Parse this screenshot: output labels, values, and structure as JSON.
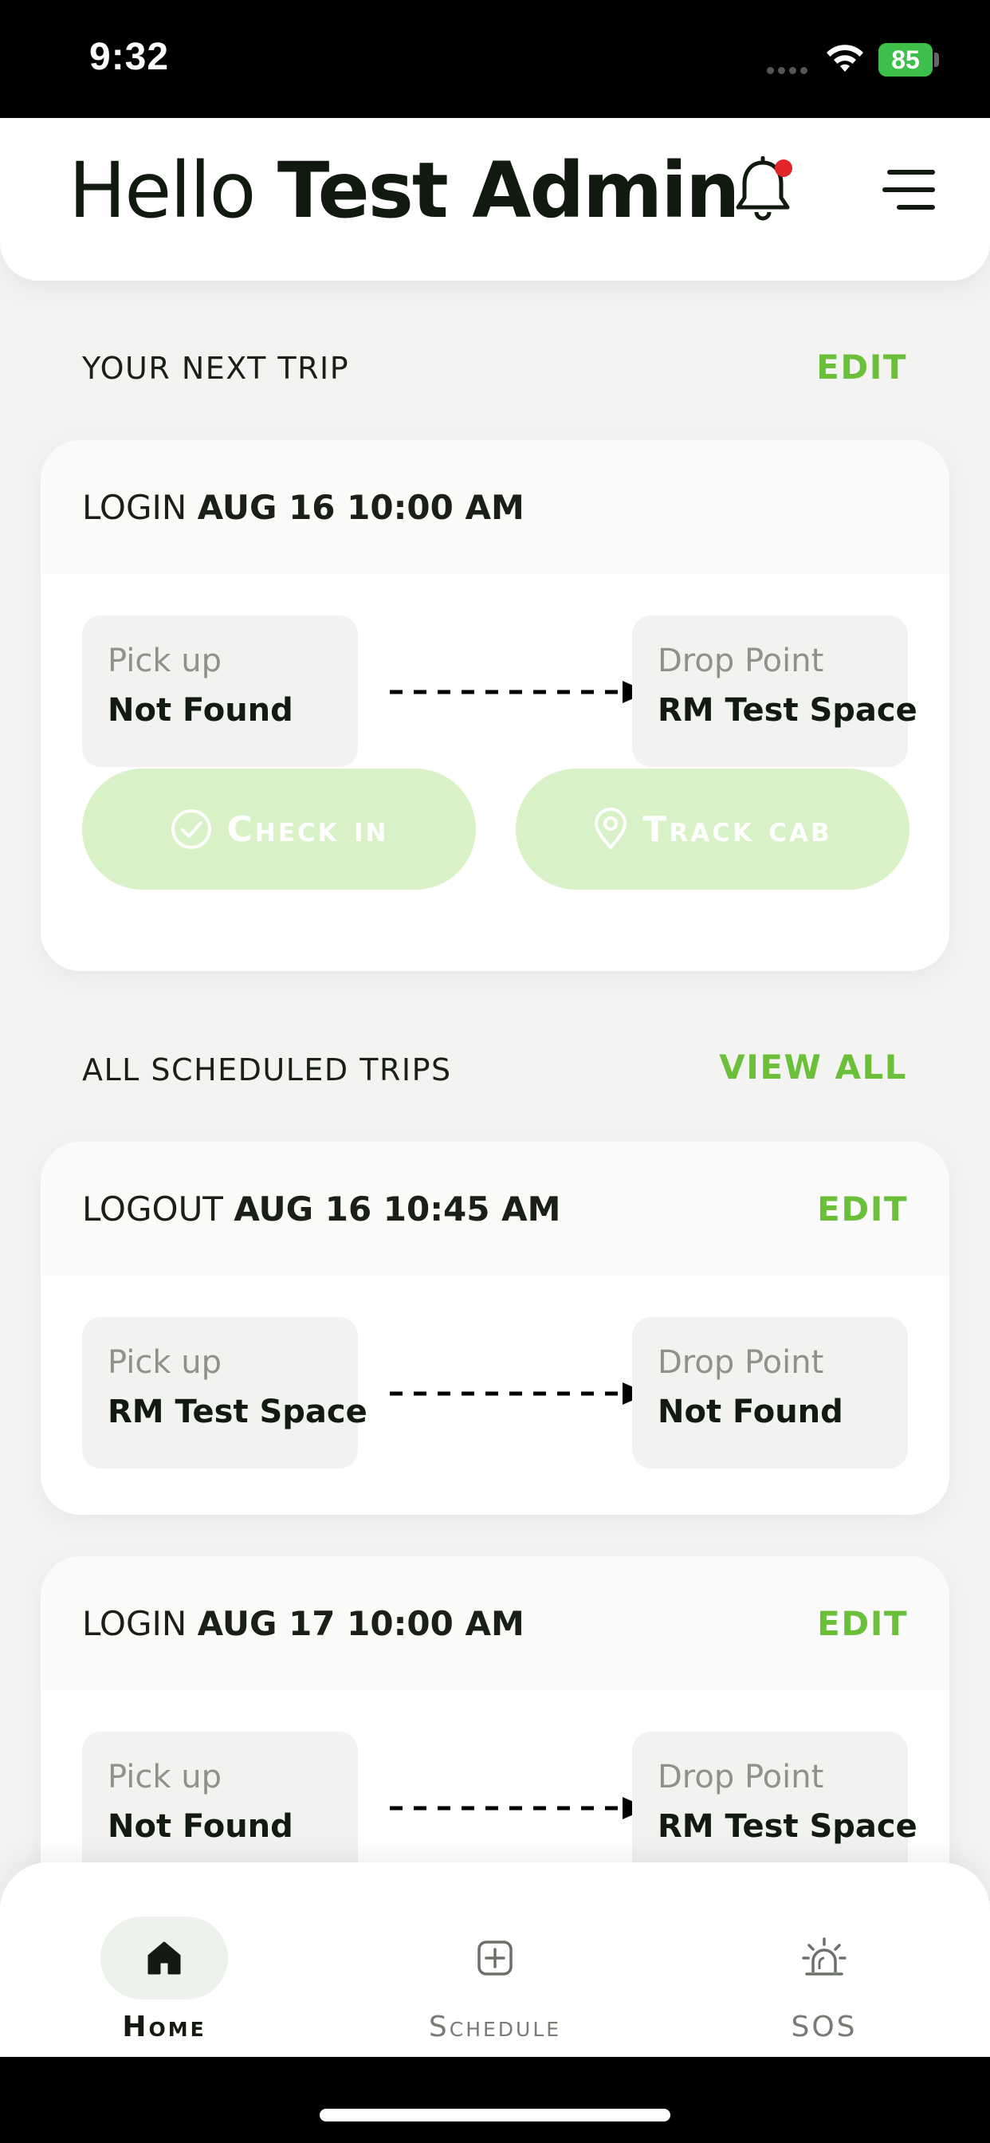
{
  "status_bar": {
    "time": "9:32",
    "battery": "85"
  },
  "header": {
    "greeting": "Hello",
    "user_name": "Test Admin"
  },
  "next_trip": {
    "section_title": "YOUR NEXT TRIP",
    "action_label": "EDIT",
    "trip": {
      "type": "LOGIN",
      "when": "AUG 16 10:00 AM",
      "pickup_label": "Pick up",
      "pickup_value": "Not Found",
      "drop_label": "Drop Point",
      "drop_value": "RM Test Space"
    },
    "check_in_label": "Check in",
    "track_cab_label": "Track cab"
  },
  "scheduled": {
    "section_title": "ALL SCHEDULED TRIPS",
    "action_label": "VIEW ALL",
    "trips": [
      {
        "type": "LOGOUT",
        "when": "AUG 16 10:45 AM",
        "edit_label": "EDIT",
        "pickup_label": "Pick up",
        "pickup_value": "RM Test Space",
        "drop_label": "Drop Point",
        "drop_value": "Not Found"
      },
      {
        "type": "LOGIN",
        "when": "AUG 17 10:00 AM",
        "edit_label": "EDIT",
        "pickup_label": "Pick up",
        "pickup_value": "Not Found",
        "drop_label": "Drop Point",
        "drop_value": "RM Test Space"
      }
    ]
  },
  "bottom_nav": {
    "items": [
      {
        "label": "Home",
        "icon": "home-icon",
        "active": true
      },
      {
        "label": "Schedule",
        "icon": "plus-square-icon",
        "active": false
      },
      {
        "label": "SOS",
        "icon": "siren-icon",
        "active": false
      }
    ]
  },
  "colors": {
    "accent": "#6bbf3a",
    "button_disabled": "#d8f1c7",
    "notification_dot": "#e0262b",
    "background": "#f3f4f2"
  }
}
